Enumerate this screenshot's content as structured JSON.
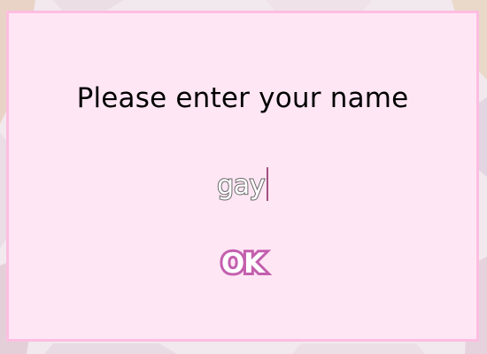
{
  "dialog": {
    "prompt": "Please enter your name",
    "name_value": "gay",
    "ok_label": "OK"
  },
  "colors": {
    "dialog_background": "#ffe6f4",
    "dialog_border": "#ffbde1",
    "ok_outline": "#c35fae",
    "name_outline": "#6a6a6a"
  }
}
